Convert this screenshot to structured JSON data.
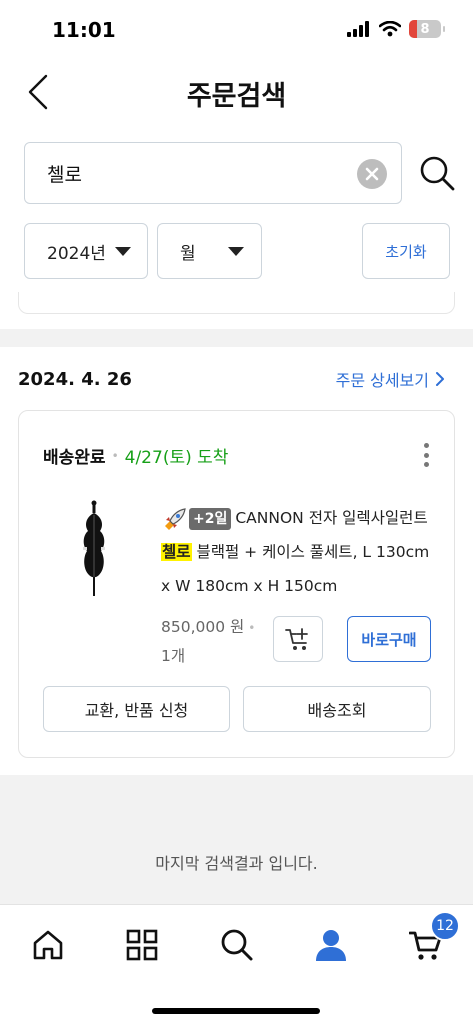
{
  "status_bar": {
    "time": "11:01",
    "battery_level": "8"
  },
  "header": {
    "title": "주문검색"
  },
  "search": {
    "query": "첼로"
  },
  "filters": {
    "year": "2024년",
    "month": "월",
    "reset_label": "초기화"
  },
  "order": {
    "date": "2024. 4. 26",
    "detail_link": "주문 상세보기",
    "status": "배송완료",
    "arrival": "4/27(토) 도착",
    "product": {
      "badge": "+2일",
      "title_before": "CANNON 전자 일렉사일런트 ",
      "title_highlight": "첼로",
      "title_after": " 블랙펄 + 케이스 풀세트, L 130cm x W 180cm x H 150cm",
      "price": "850,000 원",
      "quantity": "1개"
    },
    "buy_label": "바로구매",
    "exchange_label": "교환, 반품 신청",
    "tracking_label": "배송조회"
  },
  "end_message": "마지막 검색결과 입니다.",
  "tab_bar": {
    "cart_count": "12"
  },
  "colors": {
    "accent": "#2f6fd6",
    "arrival_green": "#17a018",
    "highlight": "#fff200",
    "band_gray": "#f2f2f2"
  }
}
